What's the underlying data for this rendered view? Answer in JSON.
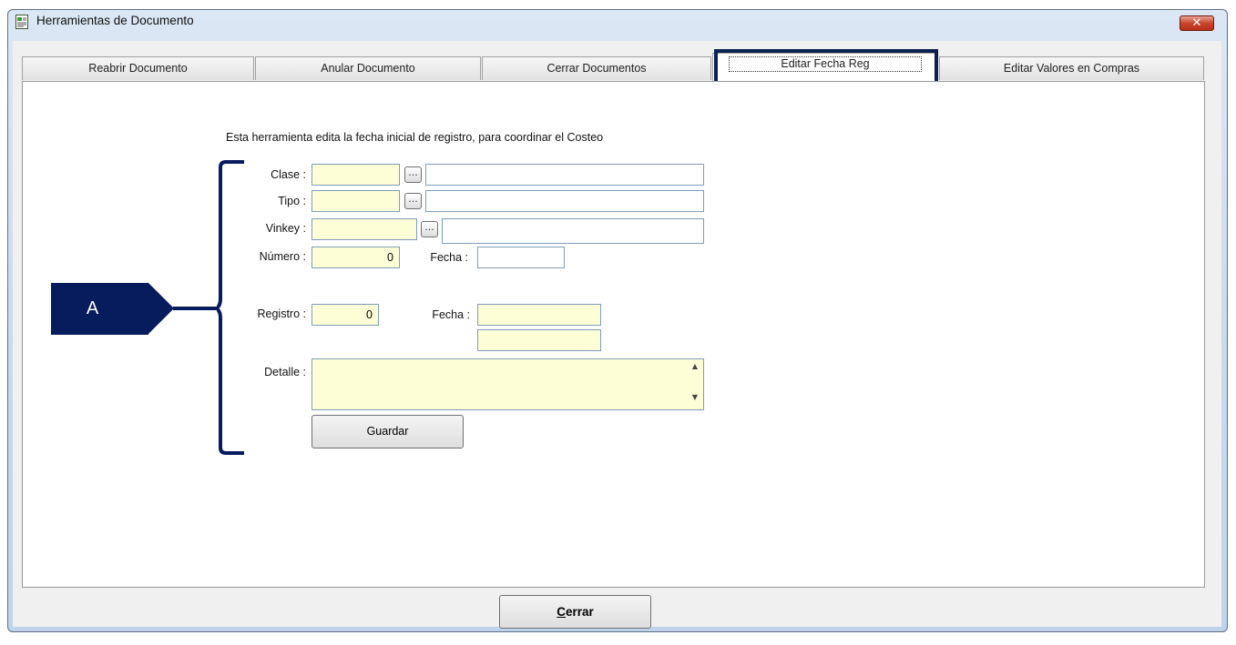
{
  "window": {
    "title": "Herramientas de Documento",
    "close_label": "✕"
  },
  "tabs": [
    {
      "label": "Reabrir Documento"
    },
    {
      "label": "Anular Documento"
    },
    {
      "label": "Cerrar Documentos"
    },
    {
      "label": "Editar Fecha Reg"
    },
    {
      "label": "Editar Valores en Compras"
    }
  ],
  "active_tab_index": 3,
  "form": {
    "description": "Esta herramienta edita la fecha inicial de registro, para coordinar el Costeo",
    "clase_label": "Clase :",
    "tipo_label": "Tipo :",
    "vinkey_label": "Vinkey :",
    "numero_label": "Número :",
    "numero_value": "0",
    "fecha_label": "Fecha :",
    "registro_label": "Registro :",
    "registro_value": "0",
    "fecha2_label": "Fecha :",
    "detalle_label": "Detalle :",
    "lookup_label": "...",
    "guardar_label": "Guardar"
  },
  "footer": {
    "cerrar_label": "Cerrar",
    "cerrar_mnemonic": "C"
  },
  "annotation": {
    "label": "A"
  },
  "colors": {
    "input_yellow": "#fefed6",
    "annotation_navy": "#071c5c",
    "close_red": "#c8472d"
  }
}
